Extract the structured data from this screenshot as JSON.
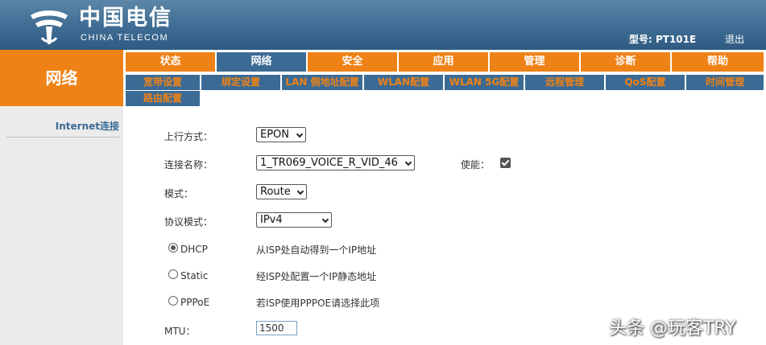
{
  "header": {
    "logo_cn": "中国电信",
    "logo_en": "CHINA TELECOM",
    "model": "型号: PT101E",
    "logout": "退出"
  },
  "section_title": "网络",
  "main_tabs": [
    {
      "label": "状态",
      "active": false
    },
    {
      "label": "网络",
      "active": true
    },
    {
      "label": "安全",
      "active": false
    },
    {
      "label": "应用",
      "active": false
    },
    {
      "label": "管理",
      "active": false
    },
    {
      "label": "诊断",
      "active": false
    },
    {
      "label": "帮助",
      "active": false
    }
  ],
  "sub_tabs": [
    "宽带设置",
    "绑定设置",
    "LAN 侧地址配置",
    "WLAN配置",
    "WLAN 5G配置",
    "远程管理",
    "QoS配置",
    "时间管理",
    "路由配置"
  ],
  "sidebar": {
    "items": [
      "Internet连接"
    ]
  },
  "form": {
    "uplink_label": "上行方式：",
    "uplink_value": "EPON",
    "conn_label": "连接名称：",
    "conn_value": "1_TR069_VOICE_R_VID_46",
    "enable_label": "使能：",
    "mode_label": "模式：",
    "mode_value": "Route",
    "proto_label": "协议模式：",
    "proto_value": "IPv4",
    "dhcp_label": "DHCP",
    "dhcp_desc": "从ISP处自动得到一个IP地址",
    "static_label": "Static",
    "static_desc": "经ISP处配置一个IP静态地址",
    "pppoe_label": "PPPoE",
    "pppoe_desc": "若ISP使用PPPOE请选择此项",
    "mtu_label": "MTU：",
    "mtu_value": "1500"
  },
  "watermark": "头条 @玩客TRY"
}
